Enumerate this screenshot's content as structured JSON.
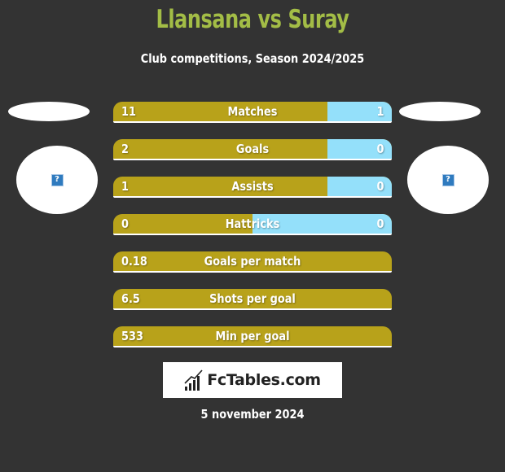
{
  "header": {
    "title": "Llansana vs Suray",
    "subtitle": "Club competitions, Season 2024/2025"
  },
  "colors": {
    "background": "#333333",
    "title": "#a3bd46",
    "left_bar": "#b8a21a",
    "right_bar": "#94e0fa"
  },
  "teams": {
    "left": {
      "name": "Llansana",
      "logo_icon": "question-mark-icon"
    },
    "right": {
      "name": "Suray",
      "logo_icon": "question-mark-icon"
    }
  },
  "stats": [
    {
      "label": "Matches",
      "left": "11",
      "right": "1",
      "right_share": 0.23
    },
    {
      "label": "Goals",
      "left": "2",
      "right": "0",
      "right_share": 0.23
    },
    {
      "label": "Assists",
      "left": "1",
      "right": "0",
      "right_share": 0.23
    },
    {
      "label": "Hattricks",
      "left": "0",
      "right": "0",
      "right_share": 0.5
    },
    {
      "label": "Goals per match",
      "left": "0.18",
      "right": "",
      "right_share": 0
    },
    {
      "label": "Shots per goal",
      "left": "6.5",
      "right": "",
      "right_share": 0
    },
    {
      "label": "Min per goal",
      "left": "533",
      "right": "",
      "right_share": 0
    }
  ],
  "footer": {
    "brand": "FcTables.com",
    "brand_icon": "bar-chart-icon",
    "date": "5 november 2024"
  }
}
